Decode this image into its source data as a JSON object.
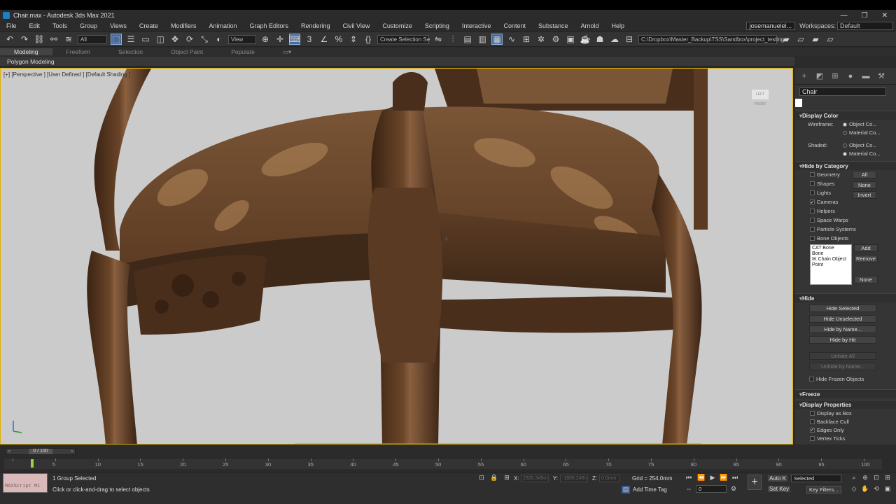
{
  "window": {
    "title": "Chair.max - Autodesk 3ds Max 2021",
    "controls": [
      "—",
      "❐",
      "✕"
    ]
  },
  "menu": {
    "items": [
      "File",
      "Edit",
      "Tools",
      "Group",
      "Views",
      "Create",
      "Modifiers",
      "Animation",
      "Graph Editors",
      "Rendering",
      "Civil View",
      "Customize",
      "Scripting",
      "Interactive",
      "Content",
      "Substance",
      "Arnold",
      "Help"
    ],
    "user": "josemanuelel...",
    "workspaces_label": "Workspaces:",
    "workspace": "Default"
  },
  "toolbar": {
    "selection_filter": "All",
    "ref_coord": "View",
    "named_selection": "Create Selection Se",
    "project_path": "C:\\Dropbox\\Master_Backup\\TSS\\Sandbox\\project_testing"
  },
  "ribbon": {
    "tabs": [
      "Modeling",
      "Freeform",
      "Selection",
      "Object Paint",
      "Populate"
    ],
    "active": "Modeling",
    "sub": "Polygon Modeling"
  },
  "viewport": {
    "label": "[+] [Perspective ] [User Defined ] [Default Shading ]",
    "viewcube": "LEFT FRONT"
  },
  "panel": {
    "object_name": "Chair",
    "display_color": {
      "title": "Display Color",
      "wireframe_label": "Wireframe:",
      "shaded_label": "Shaded:",
      "opt1": "Object Co...",
      "opt2": "Material Co..."
    },
    "hide_by_category": {
      "title": "Hide by Category",
      "items": [
        {
          "label": "Geometry",
          "checked": false
        },
        {
          "label": "Shapes",
          "checked": false
        },
        {
          "label": "Lights",
          "checked": false
        },
        {
          "label": "Cameras",
          "checked": true
        },
        {
          "label": "Helpers",
          "checked": false
        },
        {
          "label": "Space Warps",
          "checked": false
        },
        {
          "label": "Particle Systems",
          "checked": false
        },
        {
          "label": "Bone Objects",
          "checked": false
        }
      ],
      "btn_all": "All",
      "btn_none": "None",
      "btn_invert": "Invert",
      "list": [
        "CAT Bone",
        "Bone",
        "IK Chain Object",
        "Point"
      ],
      "btn_add": "Add",
      "btn_remove": "Remove",
      "btn_none2": "None"
    },
    "hide": {
      "title": "Hide",
      "buttons": [
        "Hide Selected",
        "Hide Unselected",
        "Hide by Name...",
        "Hide by Hit"
      ],
      "disabled": [
        "Unhide All",
        "Unhide by Name..."
      ],
      "frozen": "Hide Frozen Objects"
    },
    "freeze": {
      "title": "Freeze"
    },
    "display_properties": {
      "title": "Display Properties",
      "items": [
        {
          "label": "Display as Box",
          "checked": false
        },
        {
          "label": "Backface Cull",
          "checked": false
        },
        {
          "label": "Edges Only",
          "checked": true
        },
        {
          "label": "Vertex Ticks",
          "checked": false
        }
      ]
    }
  },
  "timeline": {
    "slider": "0 / 100",
    "ticks": [
      "0",
      "5",
      "10",
      "15",
      "20",
      "25",
      "30",
      "35",
      "40",
      "45",
      "50",
      "55",
      "60",
      "65",
      "70",
      "75",
      "80",
      "85",
      "90",
      "95",
      "100"
    ]
  },
  "status": {
    "maxscript": "MAXScript Mi",
    "selection": "1 Group Selected",
    "prompt": "Click or click-and-drag to select objects",
    "x_label": "X:",
    "x": "2326.349m",
    "y_label": "Y:",
    "y": "-1809.249n",
    "z_label": "Z:",
    "z": "0.0mm",
    "grid": "Grid = 254.0mm",
    "add_time_tag": "Add Time Tag",
    "auto_key": "Auto K",
    "set_key": "Set Key",
    "key_mode": "Selected",
    "key_filters": "Key Filters...",
    "frame": "0"
  }
}
